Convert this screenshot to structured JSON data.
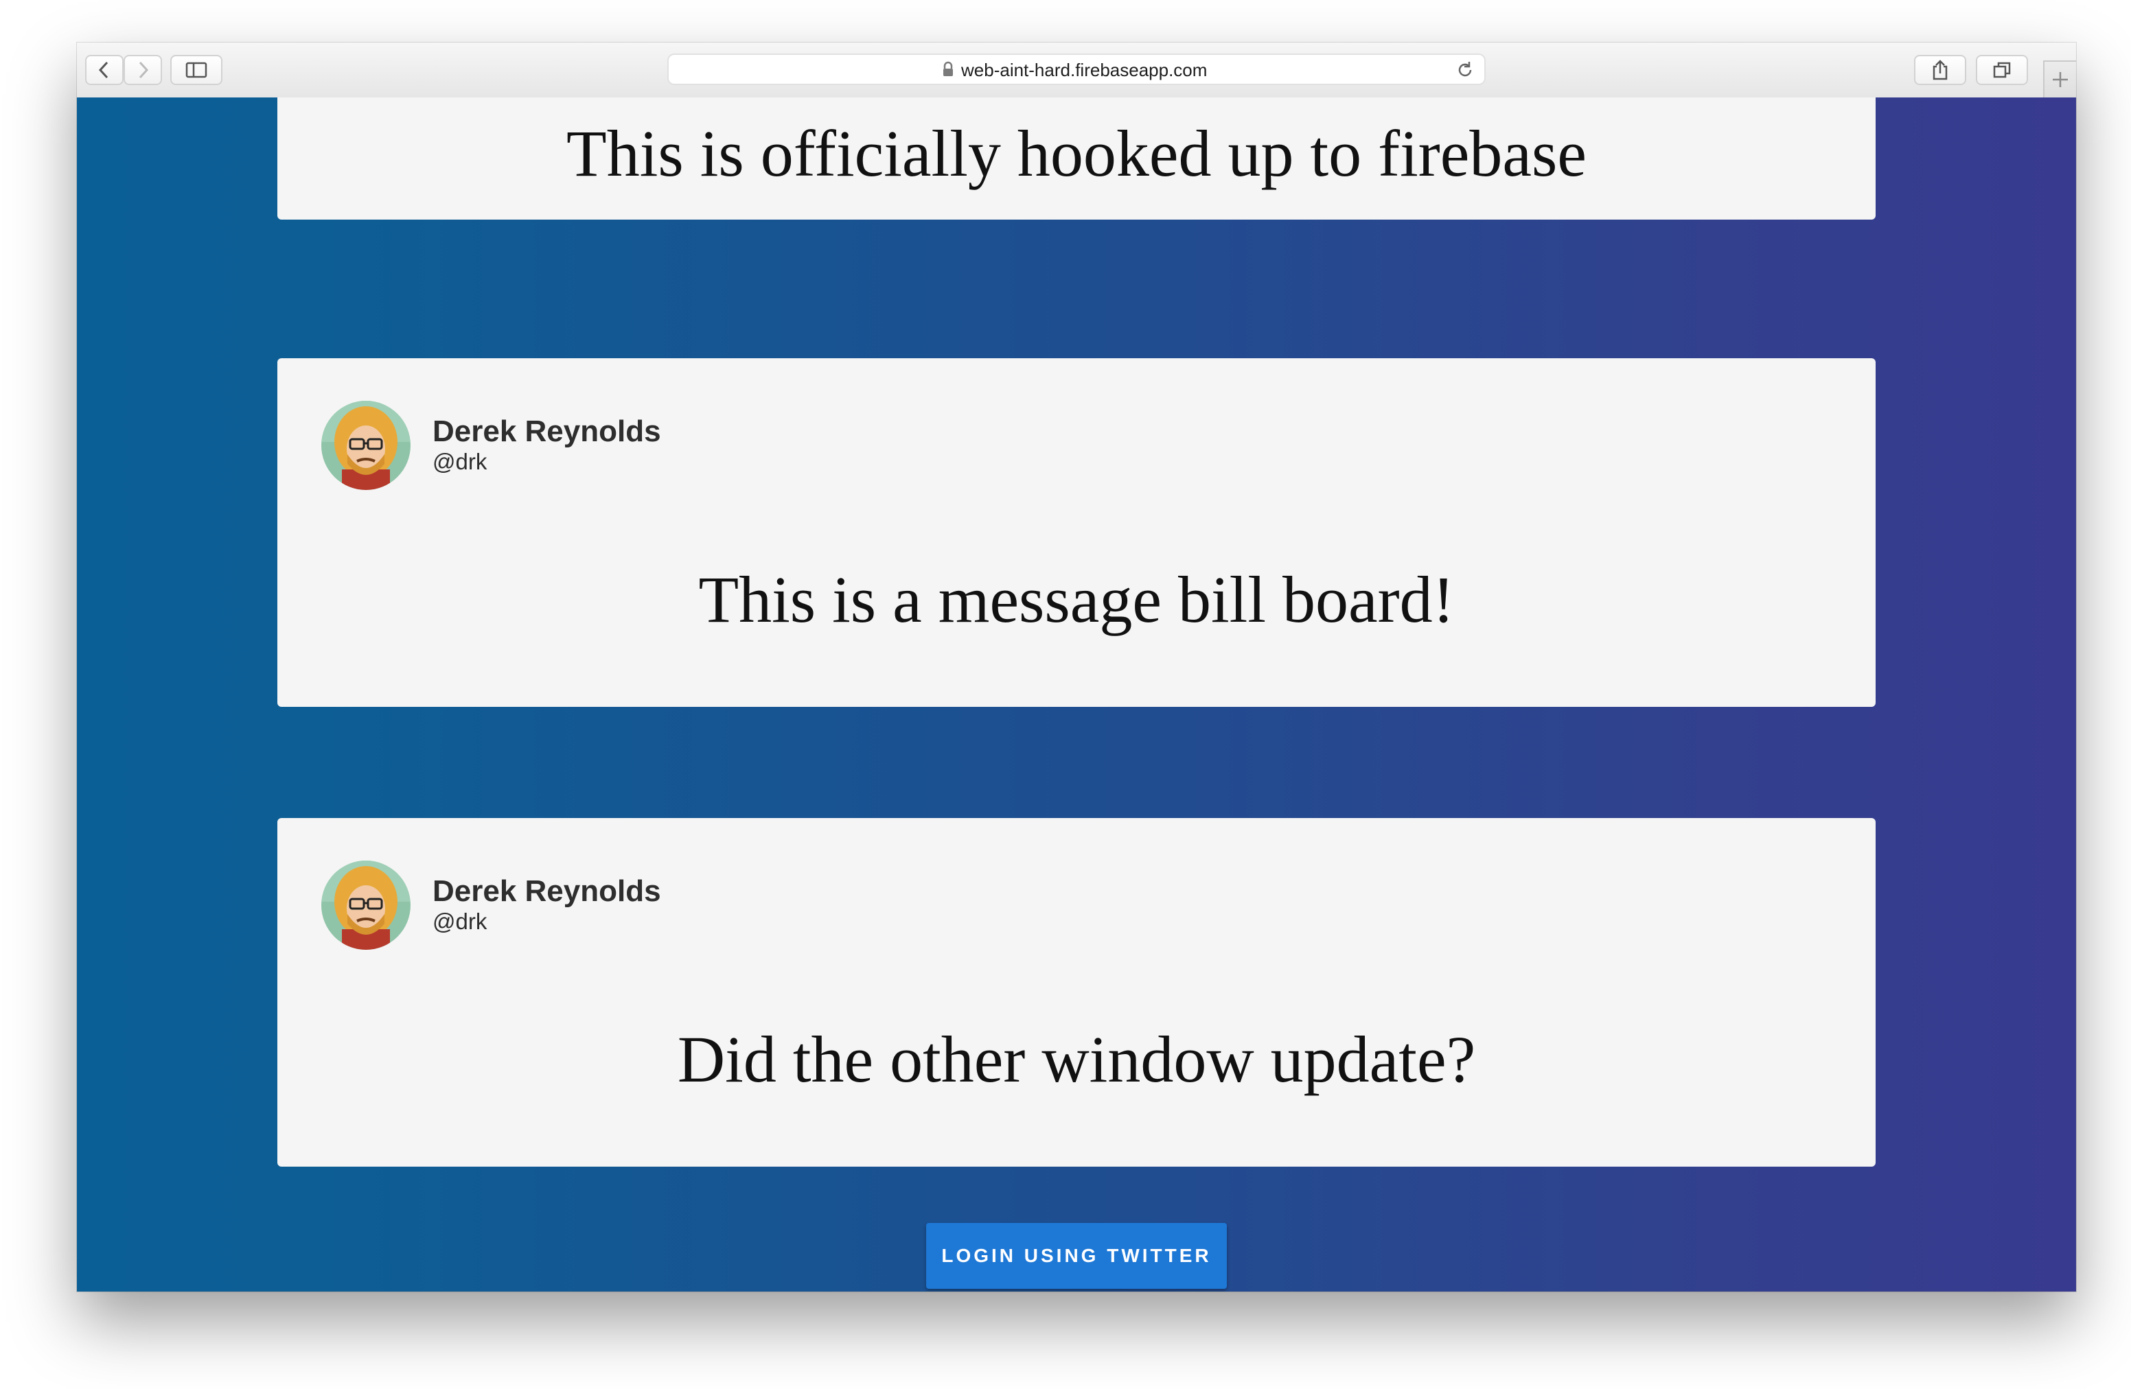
{
  "browser": {
    "url": "web-aint-hard.firebaseapp.com",
    "icons": [
      "back-icon",
      "forward-icon",
      "sidebar-icon",
      "lock-icon",
      "reload-icon",
      "share-icon",
      "tabs-icon",
      "new-tab-icon"
    ]
  },
  "theme": {
    "background_gradient": [
      "#0a5f96",
      "#383a8f"
    ],
    "card_background": "#f5f5f5",
    "button_color": "#1e78d6"
  },
  "messages": [
    {
      "text": "This is officially hooked up to firebase"
    },
    {
      "author_name": "Derek Reynolds",
      "author_handle": "@drk",
      "text": "This is a message bill board!"
    },
    {
      "author_name": "Derek Reynolds",
      "author_handle": "@drk",
      "text": "Did the other window update?"
    }
  ],
  "actions": {
    "login_label": "LOGIN USING TWITTER"
  }
}
